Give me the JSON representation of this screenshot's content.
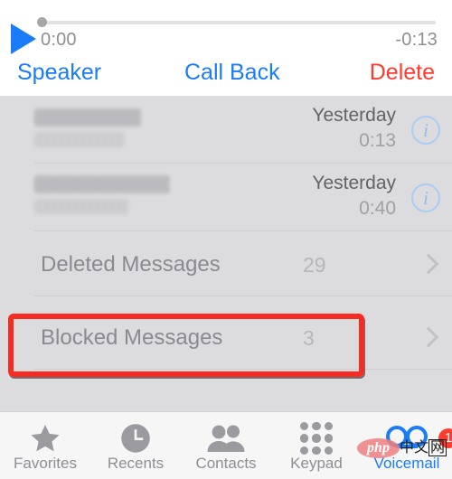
{
  "player": {
    "play_icon": "play-triangle-icon",
    "elapsed": "0:00",
    "remaining": "-0:13",
    "scrubber_position_percent": 0
  },
  "actions": {
    "speaker_label": "Speaker",
    "call_back_label": "Call Back",
    "delete_label": "Delete",
    "accent_color": "#1a7cf9",
    "destructive_color": "#ff3b30"
  },
  "voicemails": [
    {
      "name": "",
      "name_redacted": true,
      "subtitle": "",
      "date": "Yesterday",
      "duration": "0:13",
      "info_icon": "info-circle-icon"
    },
    {
      "name": "",
      "name_redacted": true,
      "subtitle": "",
      "date": "Yesterday",
      "duration": "0:40",
      "info_icon": "info-circle-icon"
    }
  ],
  "folders": [
    {
      "label": "Deleted Messages",
      "count": "29",
      "highlighted": false
    },
    {
      "label": "Blocked Messages",
      "count": "3",
      "highlighted": true
    }
  ],
  "highlight": {
    "color": "#f62b22",
    "target": "Blocked Messages"
  },
  "tabbar": {
    "items": [
      {
        "label": "Favorites",
        "icon": "star-icon",
        "active": false
      },
      {
        "label": "Recents",
        "icon": "clock-icon",
        "active": false
      },
      {
        "label": "Contacts",
        "icon": "contacts-icon",
        "active": false
      },
      {
        "label": "Keypad",
        "icon": "keypad-icon",
        "active": false
      },
      {
        "label": "Voicemail",
        "icon": "voicemail-reels-icon",
        "active": true,
        "badge": "1"
      }
    ],
    "active_color": "#1a7cf9",
    "inactive_color": "#8e8e93"
  },
  "watermark": {
    "php_text": "php",
    "cn_text_1": "中文",
    "cn_text_2": "网"
  }
}
